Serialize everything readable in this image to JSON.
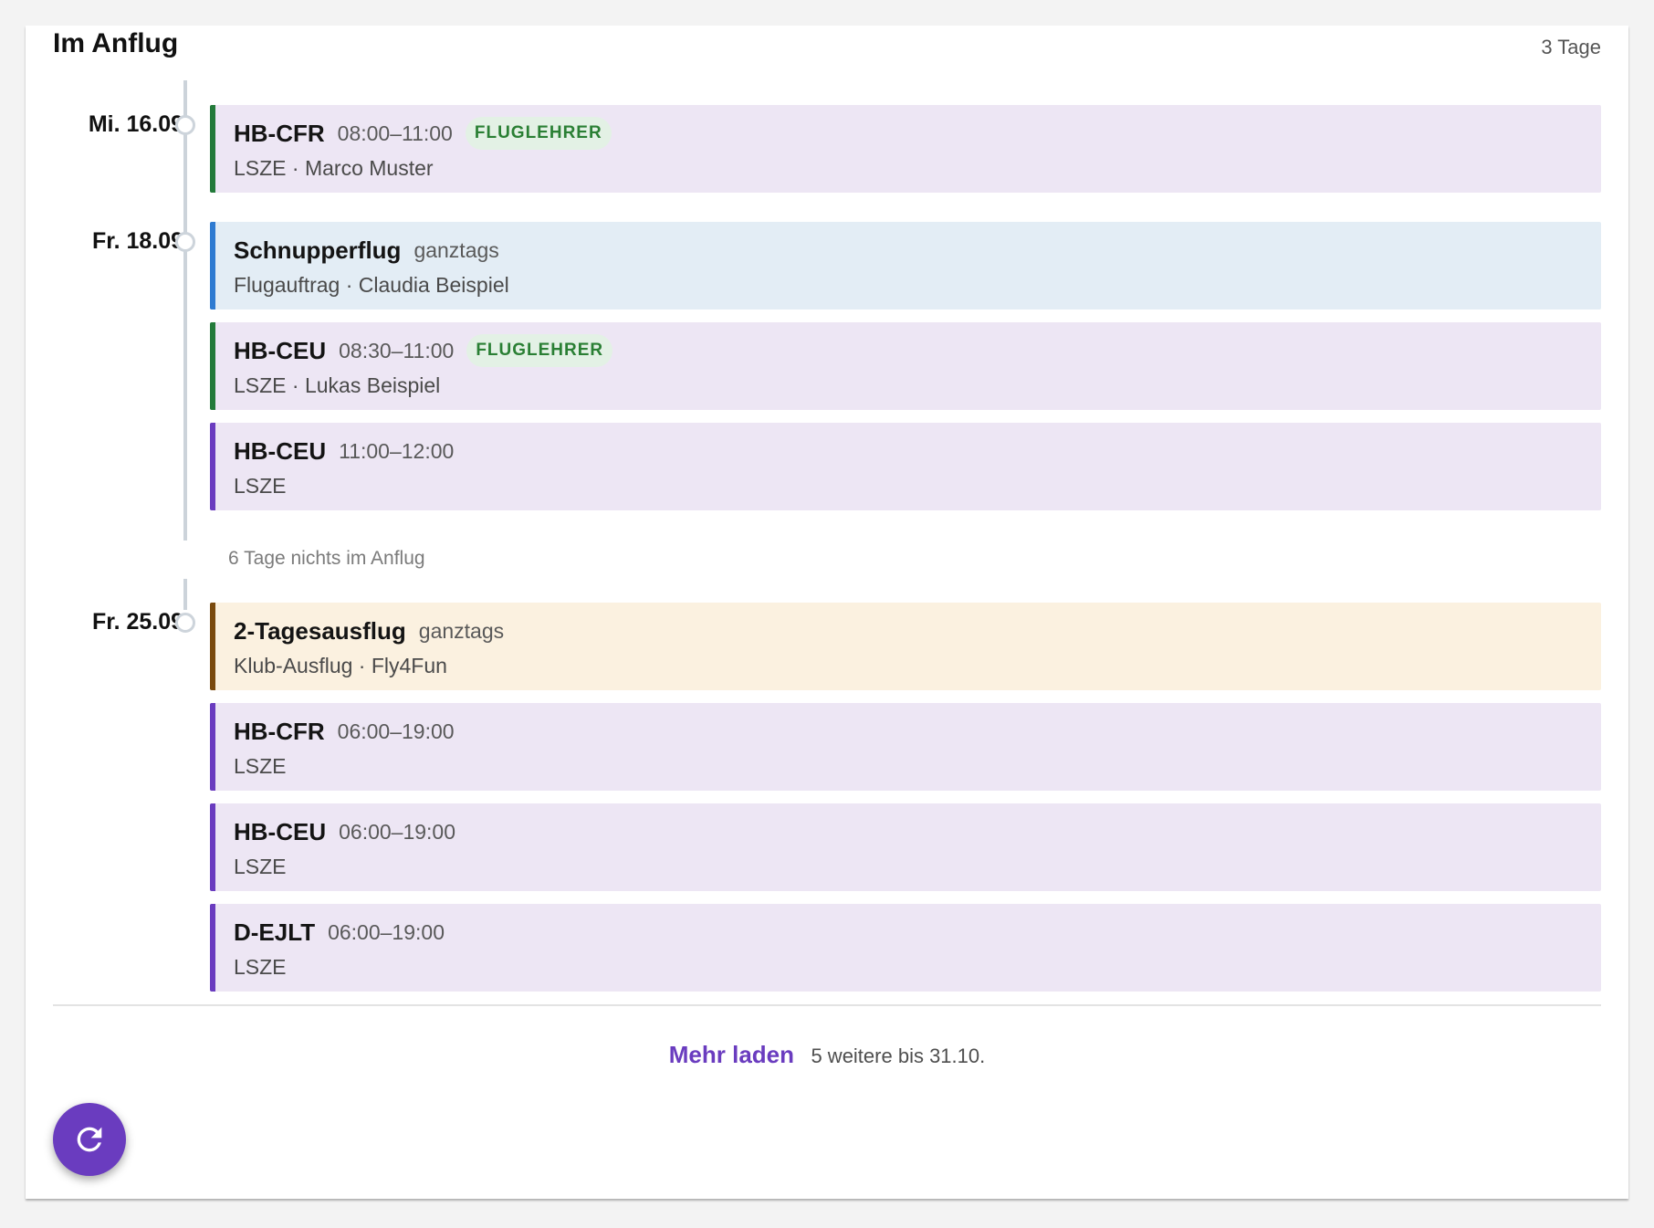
{
  "section": {
    "title": "Im Anflug",
    "days_count": "3 Tage"
  },
  "colors": {
    "aircraft": "#6a3cbf",
    "instructor": "#237a3a",
    "order": "#2f7bd1",
    "club": "#7a4a0e"
  },
  "days": [
    {
      "date": "Mi. 16.09.",
      "events": [
        {
          "title": "HB-CFR",
          "time": "08:00–11:00",
          "badge": "FLUGLEHRER",
          "subtitle": "LSZE · Marco Muster",
          "accent": "#237a3a",
          "bg": "#ede6f4"
        }
      ]
    },
    {
      "date": "Fr. 18.09.",
      "events": [
        {
          "title": "Schnupperflug",
          "time": "ganztags",
          "subtitle": "Flugauftrag · Claudia Beispiel",
          "accent": "#2f7bd1",
          "bg": "#e3edf5"
        },
        {
          "title": "HB-CEU",
          "time": "08:30–11:00",
          "badge": "FLUGLEHRER",
          "subtitle": "LSZE · Lukas Beispiel",
          "accent": "#237a3a",
          "bg": "#ede6f4"
        },
        {
          "title": "HB-CEU",
          "time": "11:00–12:00",
          "subtitle": "LSZE",
          "accent": "#6a3cbf",
          "bg": "#ede6f4"
        }
      ]
    },
    {
      "date": "Fr. 25.09.",
      "events": [
        {
          "title": "2-Tagesausflug",
          "time": "ganztags",
          "subtitle": "Klub-Ausflug · Fly4Fun",
          "accent": "#7a4a0e",
          "bg": "#fbf1e0"
        },
        {
          "title": "HB-CFR",
          "time": "06:00–19:00",
          "subtitle": "LSZE",
          "accent": "#6a3cbf",
          "bg": "#ede6f4"
        },
        {
          "title": "HB-CEU",
          "time": "06:00–19:00",
          "subtitle": "LSZE",
          "accent": "#6a3cbf",
          "bg": "#ede6f4"
        },
        {
          "title": "D-EJLT",
          "time": "06:00–19:00",
          "subtitle": "LSZE",
          "accent": "#6a3cbf",
          "bg": "#ede6f4"
        }
      ]
    }
  ],
  "gap_text": "6 Tage nichts im Anflug",
  "load_more": {
    "label": "Mehr laden",
    "info": "5 weitere bis 31.10."
  },
  "fab": {
    "icon": "refresh-icon"
  }
}
